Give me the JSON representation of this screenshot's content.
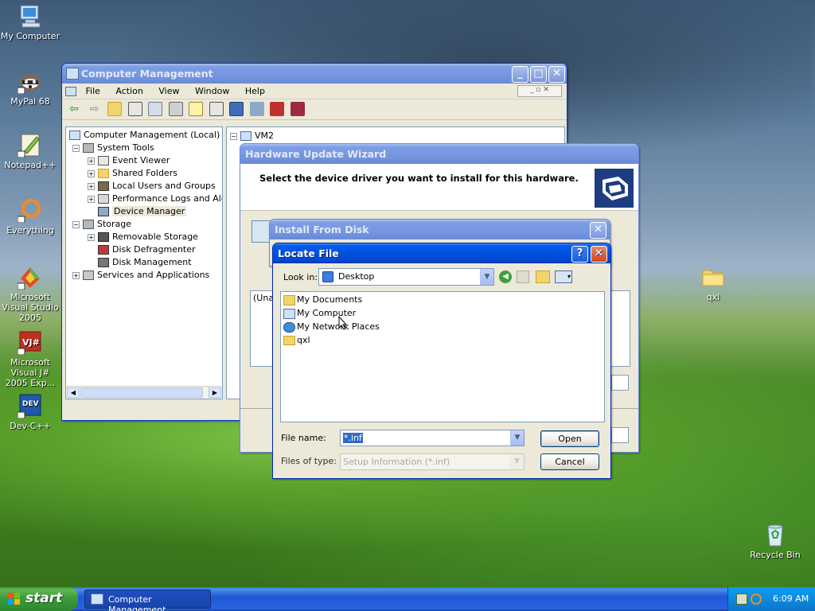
{
  "desktop": {
    "icons": [
      {
        "label": "My Computer",
        "icon": "my-computer-icon"
      },
      {
        "label": "MyPal 68",
        "icon": "mypal-icon"
      },
      {
        "label": "Notepad++",
        "icon": "notepadpp-icon"
      },
      {
        "label": "Everything",
        "icon": "everything-icon"
      },
      {
        "label": "Microsoft Visual Studio 2005",
        "icon": "visual-studio-icon"
      },
      {
        "label": "Microsoft Visual J# 2005 Exp...",
        "icon": "visual-jsharp-icon"
      },
      {
        "label": "Dev-C++",
        "icon": "devcpp-icon"
      },
      {
        "label": "qxl",
        "icon": "folder-icon"
      },
      {
        "label": "Recycle Bin",
        "icon": "recycle-bin-icon"
      }
    ]
  },
  "compmgmt": {
    "title": "Computer Management",
    "menu": [
      "File",
      "Action",
      "View",
      "Window",
      "Help"
    ],
    "tree": [
      {
        "label": "Computer Management (Local)",
        "icon": "computer-icon"
      },
      {
        "label": "System Tools",
        "icon": "tools-icon"
      },
      {
        "label": "Event Viewer",
        "icon": "event-viewer-icon"
      },
      {
        "label": "Shared Folders",
        "icon": "shared-folder-icon"
      },
      {
        "label": "Local Users and Groups",
        "icon": "users-icon"
      },
      {
        "label": "Performance Logs and Alerts",
        "icon": "perf-icon"
      },
      {
        "label": "Device Manager",
        "icon": "device-manager-icon"
      },
      {
        "label": "Storage",
        "icon": "storage-icon"
      },
      {
        "label": "Removable Storage",
        "icon": "removable-icon"
      },
      {
        "label": "Disk Defragmenter",
        "icon": "defrag-icon"
      },
      {
        "label": "Disk Management",
        "icon": "disk-mgmt-icon"
      },
      {
        "label": "Services and Applications",
        "icon": "services-icon"
      }
    ],
    "right_root": "VM2"
  },
  "wizard": {
    "title": "Hardware Update Wizard",
    "header": "Select the device driver you want to install for this hardware.",
    "list_partial": "(Una"
  },
  "install_disk": {
    "title": "Install From Disk"
  },
  "locate": {
    "title": "Locate File",
    "look_in_label": "Look in:",
    "look_in_value": "Desktop",
    "items": [
      {
        "label": "My Documents",
        "icon": "my-documents-icon"
      },
      {
        "label": "My Computer",
        "icon": "my-computer-icon"
      },
      {
        "label": "My Network Places",
        "icon": "network-places-icon"
      },
      {
        "label": "qxl",
        "icon": "folder-icon"
      }
    ],
    "file_name_label": "File name:",
    "file_name_value": "*.inf",
    "files_of_type_label": "Files of type:",
    "files_of_type_value": "Setup Information (*.inf)",
    "open_label": "Open",
    "cancel_label": "Cancel"
  },
  "taskbar": {
    "start_label": "start",
    "task_label": "Computer Management",
    "clock": "6:09 AM"
  }
}
